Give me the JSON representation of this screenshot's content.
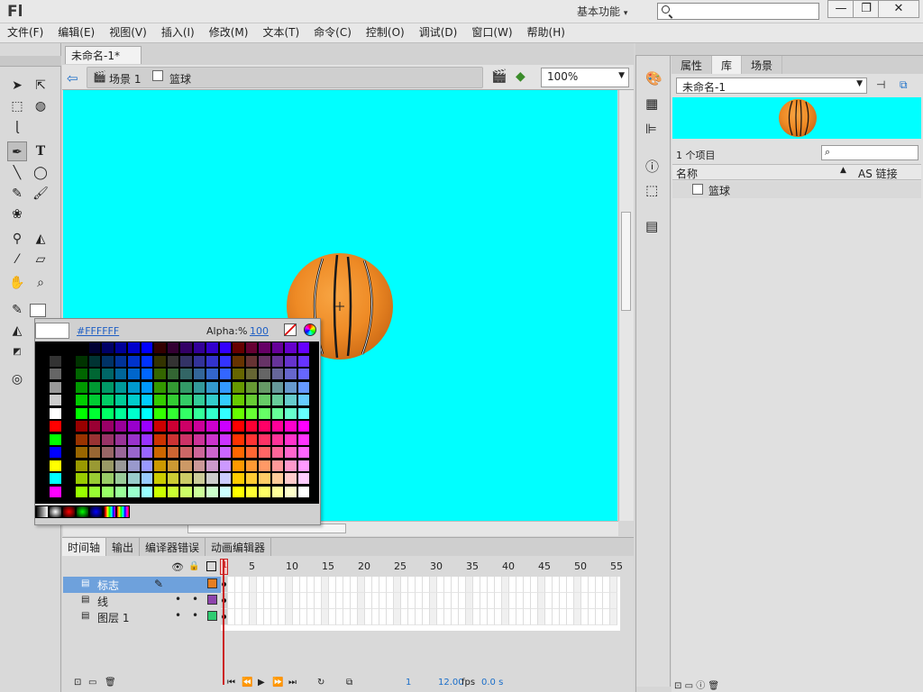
{
  "app": {
    "logo": "Fl",
    "workspace": "基本功能",
    "min": "—",
    "restore": "❐",
    "close": "✕"
  },
  "menu": [
    "文件(F)",
    "编辑(E)",
    "视图(V)",
    "插入(I)",
    "修改(M)",
    "文本(T)",
    "命令(C)",
    "控制(O)",
    "调试(D)",
    "窗口(W)",
    "帮助(H)"
  ],
  "document": {
    "tab": "未命名-1*",
    "tab_close": "×",
    "scene": "场景 1",
    "symbol": "篮球",
    "zoom": "100%"
  },
  "color_picker": {
    "hex": "#FFFFFF",
    "alpha_label": "Alpha:%",
    "alpha_value": "100"
  },
  "right_panel": {
    "tabs": [
      "属性",
      "库",
      "场景"
    ],
    "library_name": "未命名-1",
    "item_count": "1 个项目",
    "col_name": "名称",
    "col_as": "AS 链接",
    "items": [
      {
        "name": "篮球"
      }
    ]
  },
  "timeline": {
    "tabs": [
      "时间轴",
      "输出",
      "编译器错误",
      "动画编辑器"
    ],
    "layers": [
      {
        "name": "标志",
        "color": "#e67e22"
      },
      {
        "name": "线",
        "color": "#8e44ad"
      },
      {
        "name": "图层 1",
        "color": "#2ecc71"
      }
    ],
    "frame_numbers": [
      "1",
      "5",
      "10",
      "15",
      "20",
      "25",
      "30",
      "35",
      "40",
      "45",
      "50",
      "55"
    ],
    "current_frame": "1",
    "fps": "12.00",
    "fps_unit": "fps",
    "time": "0.0 s"
  }
}
